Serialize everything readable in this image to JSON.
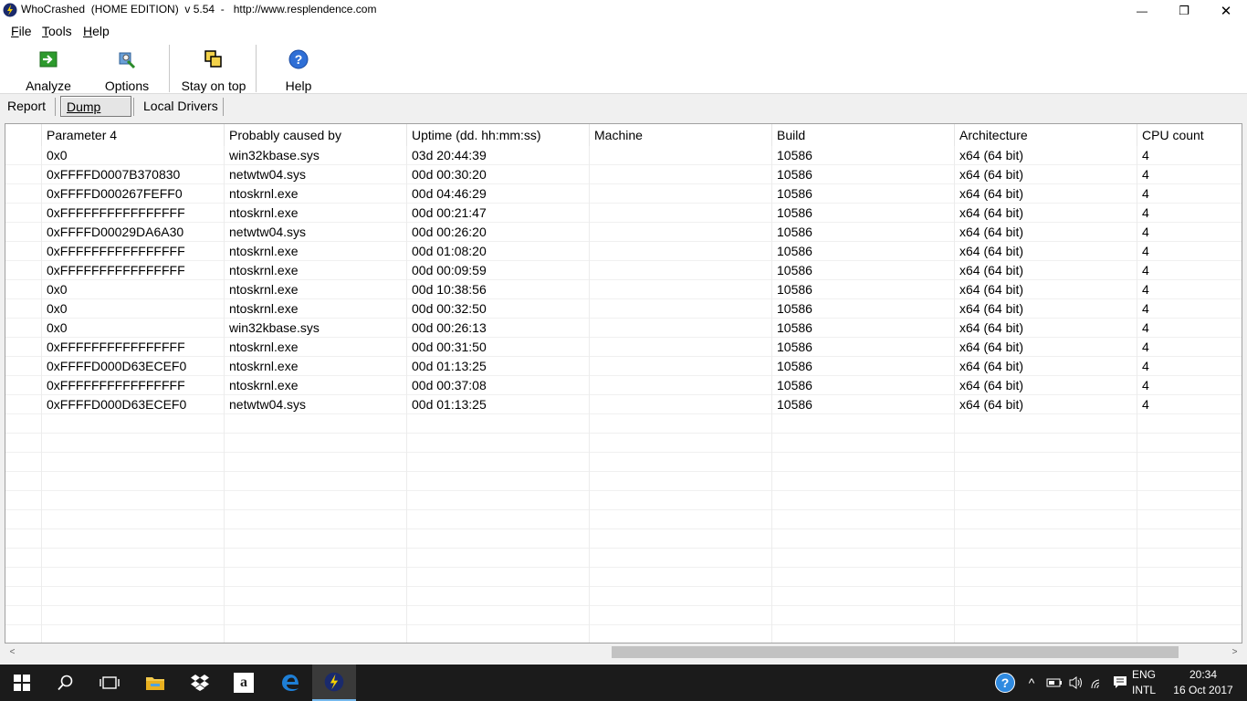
{
  "window": {
    "title": "WhoCrashed  (HOME EDITION)  v 5.54  -   http://www.resplendence.com",
    "minimize_glyph": "—",
    "restore_glyph": "❐",
    "close_glyph": "✕"
  },
  "menu": {
    "items": [
      {
        "first": "F",
        "rest": "ile"
      },
      {
        "first": "T",
        "rest": "ools"
      },
      {
        "first": "H",
        "rest": "elp"
      }
    ]
  },
  "toolbar": {
    "buttons": [
      {
        "label": "Analyze",
        "icon": "analyze-arrow-icon"
      },
      {
        "label": "Options",
        "icon": "options-icon"
      },
      {
        "label": "Stay on top",
        "icon": "stay-on-top-icon"
      },
      {
        "label": "Help",
        "icon": "help-icon"
      }
    ]
  },
  "tabs": [
    {
      "label": "Report",
      "active": false
    },
    {
      "label": "Dump files",
      "active": true
    },
    {
      "label": "Local Drivers",
      "active": false
    }
  ],
  "table": {
    "columns": [
      "Parameter 4",
      "Probably caused by",
      "Uptime (dd. hh:mm:ss)",
      "Machine",
      "Build",
      "Architecture",
      "CPU count"
    ],
    "rows": [
      [
        "0x0",
        "win32kbase.sys",
        "03d 20:44:39",
        "",
        "10586",
        "x64 (64 bit)",
        "4"
      ],
      [
        "0xFFFFD0007B370830",
        "netwtw04.sys",
        "00d 00:30:20",
        "",
        "10586",
        "x64 (64 bit)",
        "4"
      ],
      [
        "0xFFFFD000267FEFF0",
        "ntoskrnl.exe",
        "00d 04:46:29",
        "",
        "10586",
        "x64 (64 bit)",
        "4"
      ],
      [
        "0xFFFFFFFFFFFFFFFF",
        "ntoskrnl.exe",
        "00d 00:21:47",
        "",
        "10586",
        "x64 (64 bit)",
        "4"
      ],
      [
        "0xFFFFD00029DA6A30",
        "netwtw04.sys",
        "00d 00:26:20",
        "",
        "10586",
        "x64 (64 bit)",
        "4"
      ],
      [
        "0xFFFFFFFFFFFFFFFF",
        "ntoskrnl.exe",
        "00d 01:08:20",
        "",
        "10586",
        "x64 (64 bit)",
        "4"
      ],
      [
        "0xFFFFFFFFFFFFFFFF",
        "ntoskrnl.exe",
        "00d 00:09:59",
        "",
        "10586",
        "x64 (64 bit)",
        "4"
      ],
      [
        "0x0",
        "ntoskrnl.exe",
        "00d 10:38:56",
        "",
        "10586",
        "x64 (64 bit)",
        "4"
      ],
      [
        "0x0",
        "ntoskrnl.exe",
        "00d 00:32:50",
        "",
        "10586",
        "x64 (64 bit)",
        "4"
      ],
      [
        "0x0",
        "win32kbase.sys",
        "00d 00:26:13",
        "",
        "10586",
        "x64 (64 bit)",
        "4"
      ],
      [
        "0xFFFFFFFFFFFFFFFF",
        "ntoskrnl.exe",
        "00d 00:31:50",
        "",
        "10586",
        "x64 (64 bit)",
        "4"
      ],
      [
        "0xFFFFD000D63ECEF0",
        "ntoskrnl.exe",
        "00d 01:13:25",
        "",
        "10586",
        "x64 (64 bit)",
        "4"
      ],
      [
        "0xFFFFFFFFFFFFFFFF",
        "ntoskrnl.exe",
        "00d 00:37:08",
        "",
        "10586",
        "x64 (64 bit)",
        "4"
      ],
      [
        "0xFFFFD000D63ECEF0",
        "netwtw04.sys",
        "00d 01:13:25",
        "",
        "10586",
        "x64 (64 bit)",
        "4"
      ]
    ],
    "empty_rows": 12
  },
  "scrollbar": {
    "left_arrow": "<",
    "right_arrow": ">",
    "position_fraction": 0.49,
    "visible_fraction": 0.47
  },
  "taskbar": {
    "apps": [
      "start-icon",
      "search-icon",
      "task-view-icon",
      "file-explorer-icon",
      "dropbox-icon",
      "amazon-icon",
      "edge-icon",
      "whocrashed-icon"
    ],
    "amazon_glyph": "a",
    "lang_top": "ENG",
    "lang_bottom": "INTL",
    "time": "20:34",
    "date": "16 Oct 2017",
    "help_glyph": "?",
    "chevron_glyph": "^"
  },
  "colors": {
    "accent": "#76b9ed",
    "taskbar": "#1b1b1b"
  }
}
